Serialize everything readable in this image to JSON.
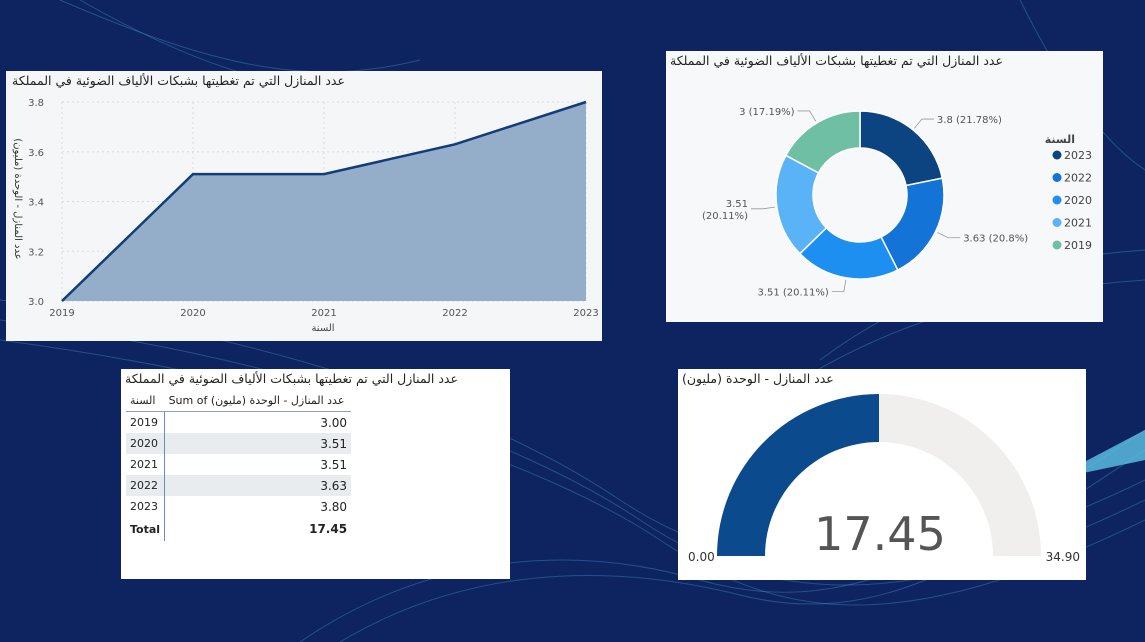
{
  "colors": {
    "background": "#0d2461",
    "area_fill": "#94aec9",
    "area_line": "#123d7a",
    "gauge_fill": "#0b4a8c",
    "gauge_track": "#f1efee"
  },
  "area_chart": {
    "title": "عدد المنازل التي تم تغطيتها بشبكات الألياف الضوئية في المملكة",
    "chart_data": {
      "type": "area",
      "title": "عدد المنازل التي تم تغطيتها بشبكات الألياف الضوئية في المملكة",
      "xlabel": "السنة",
      "ylabel": "عدد المنازل - الوحدة (مليون)",
      "x": [
        "2019",
        "2020",
        "2021",
        "2022",
        "2023"
      ],
      "values": [
        3.0,
        3.51,
        3.51,
        3.63,
        3.8
      ],
      "ylim": [
        3.0,
        3.8
      ],
      "yticks": [
        "3.0",
        "3.2",
        "3.4",
        "3.6",
        "3.8"
      ],
      "grid": true
    }
  },
  "donut_chart": {
    "title": "عدد المنازل التي تم تغطيتها بشبكات الألياف الضوئية في المملكة",
    "chart_data": {
      "type": "pie",
      "donut": true,
      "legend_title": "السنة",
      "legend_position": "right",
      "slices": [
        {
          "label": "2023",
          "value": 3.8,
          "pct": 21.78,
          "color": "#0c4482",
          "text": "3.8 (21.78%)"
        },
        {
          "label": "2022",
          "value": 3.63,
          "pct": 20.8,
          "color": "#1473d6",
          "text": "3.63 (20.8%)"
        },
        {
          "label": "2020",
          "value": 3.51,
          "pct": 20.11,
          "color": "#1d8ff0",
          "text": "3.51 (20.11%)"
        },
        {
          "label": "2021",
          "value": 3.51,
          "pct": 20.11,
          "color": "#5ab2f7",
          "text_line1": "3.51",
          "text_line2": "(20.11%)"
        },
        {
          "label": "2019",
          "value": 3.0,
          "pct": 17.19,
          "color": "#6fbfa4",
          "text": "3 (17.19%)"
        }
      ]
    }
  },
  "table": {
    "title": "عدد المنازل التي تم تغطيتها بشبكات الألياف الضوئية في المملكة",
    "col_year": "السنة",
    "col_value": "Sum of عدد المنازل - الوحدة (مليون)",
    "rows": [
      {
        "year": "2019",
        "value": "3.00"
      },
      {
        "year": "2020",
        "value": "3.51"
      },
      {
        "year": "2021",
        "value": "3.51"
      },
      {
        "year": "2022",
        "value": "3.63"
      },
      {
        "year": "2023",
        "value": "3.80"
      }
    ],
    "total_label": "Total",
    "total_value": "17.45"
  },
  "gauge": {
    "title": "عدد المنازل - الوحدة (مليون)",
    "value": "17.45",
    "min": "0.00",
    "max": "34.90",
    "fraction": 0.5
  }
}
